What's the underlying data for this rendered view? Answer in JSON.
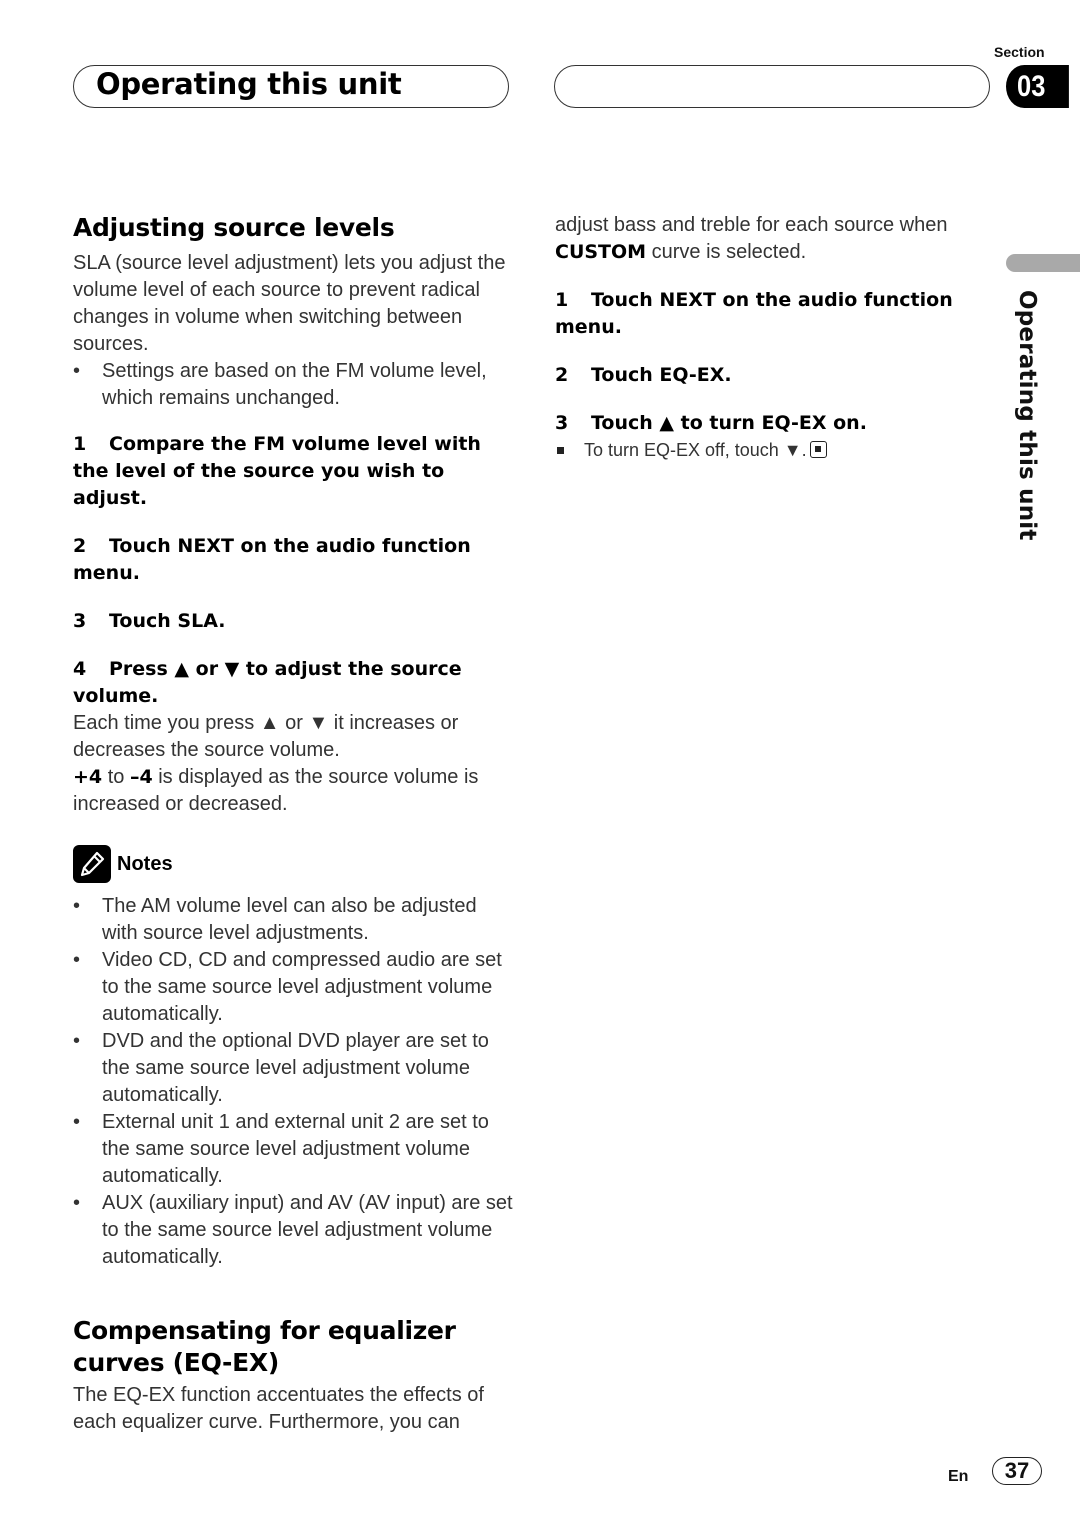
{
  "header": {
    "title": "Operating this unit",
    "section_label": "Section",
    "section_number": "03"
  },
  "side_tab": {
    "label": "Operating this unit"
  },
  "left_column": {
    "heading1": "Adjusting source levels",
    "intro": "SLA (source level adjustment) lets you adjust the volume level of each source to prevent radical changes in volume when switching between sources.",
    "intro_bullet": "Settings are based on the FM volume level, which remains unchanged.",
    "steps": [
      {
        "num": "1",
        "text": "Compare the FM volume level with the level of the source you wish to adjust."
      },
      {
        "num": "2",
        "text": "Touch NEXT on the audio function menu."
      },
      {
        "num": "3",
        "text": "Touch SLA."
      },
      {
        "num": "4",
        "text": "Press ▲ or ▼ to adjust the source volume."
      }
    ],
    "step4_body1": "Each time you press ▲ or ▼ it increases or decreases the source volume.",
    "step4_plus": "+4",
    "step4_to": " to ",
    "step4_minus": "–4",
    "step4_body2": " is displayed as the source volume is increased or decreased.",
    "notes_label": "Notes",
    "notes": [
      "The AM volume level can also be adjusted with source level adjustments.",
      "Video CD, CD and compressed audio are set to the same source level adjustment volume automatically.",
      "DVD and the optional DVD player are set to the same source level adjustment volume automatically.",
      "External unit 1 and external unit 2 are set to the same source level adjustment volume automatically.",
      "AUX (auxiliary input) and AV (AV input) are set to the same source level adjustment volume automatically."
    ],
    "heading2": "Compensating for equalizer curves (EQ-EX)",
    "eq_intro": "The EQ-EX function accentuates the effects of each equalizer curve. Furthermore, you can"
  },
  "right_column": {
    "cont_text": "adjust bass and treble for each source when ",
    "cont_bold": "CUSTOM",
    "cont_text2": " curve is selected.",
    "steps": [
      {
        "num": "1",
        "text": "Touch NEXT on the audio function menu."
      },
      {
        "num": "2",
        "text": "Touch EQ-EX."
      },
      {
        "num": "3",
        "text": "Touch ▲ to turn EQ-EX on."
      }
    ],
    "sub_note": "To turn EQ-EX off, touch ▼."
  },
  "footer": {
    "lang": "En",
    "page": "37"
  }
}
